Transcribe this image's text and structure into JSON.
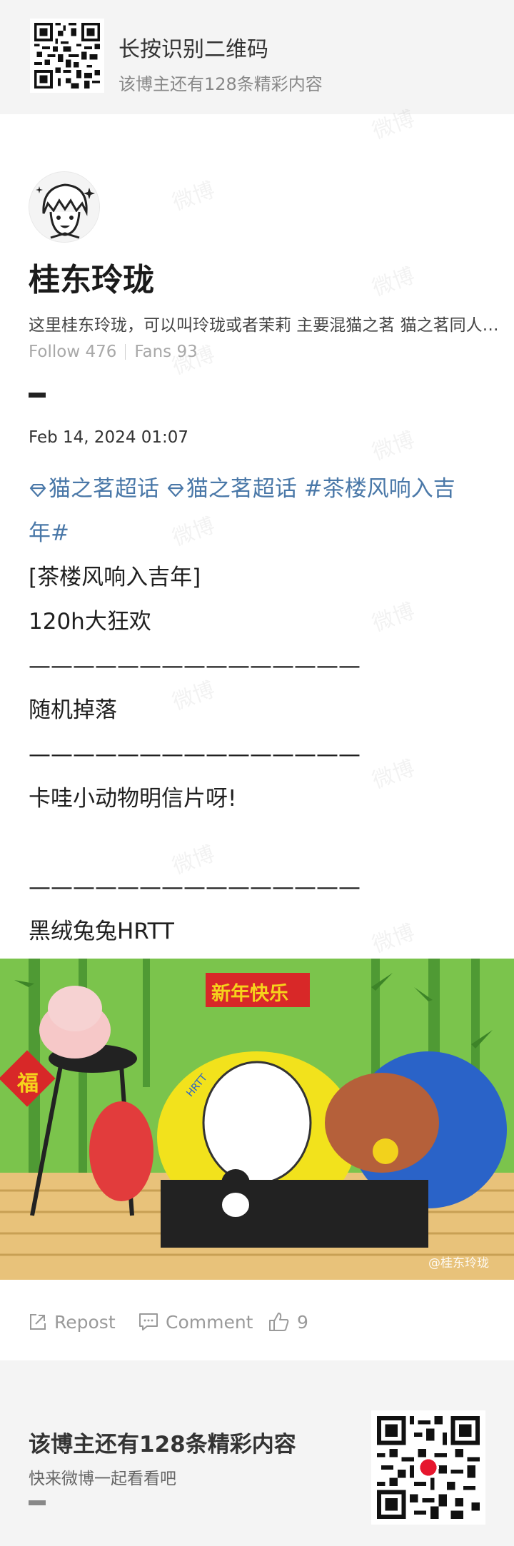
{
  "top_banner": {
    "title": "长按识别二维码",
    "subtitle": "该博主还有128条精彩内容",
    "qr_icon": "qr-code-icon"
  },
  "author": {
    "avatar_icon": "avatar-icon",
    "name": "桂东玲珑",
    "bio": "这里桂东玲珑，可以叫玲珑或者茉莉 主要混猫之茗 猫之茗同人绘画",
    "follow": "Follow 476",
    "fans": "Fans 93"
  },
  "post": {
    "date": "Feb 14, 2024 01:07",
    "topic1": "猫之茗超话",
    "topic2": "猫之茗超话",
    "topic3a": "#茶楼风响入吉",
    "topic3b": "年#",
    "line1": "[茶楼风响入吉年]",
    "line2": "120h大狂欢",
    "divider1": "———————————————",
    "line3": "随机掉落",
    "divider2": "———————————————",
    "line4": "卡哇小动物明信片呀!",
    "divider3": "———————————————",
    "line5": "黑绒兔兔HRTT"
  },
  "image": {
    "banner_text": "新年快乐",
    "fu_text": "福",
    "sign_text": "HRTT",
    "watermark": "@桂东玲珑"
  },
  "actions": {
    "repost": "Repost",
    "comment": "Comment",
    "likes": "9"
  },
  "bottom_banner": {
    "title": "该博主还有128条精彩内容",
    "subtitle": "快来微博一起看看吧",
    "qr_icon": "qr-code-icon"
  },
  "colors": {
    "topic": "#4a78a8",
    "banner_bg": "#f4f4f4",
    "image_bg": "#7bc44c"
  }
}
